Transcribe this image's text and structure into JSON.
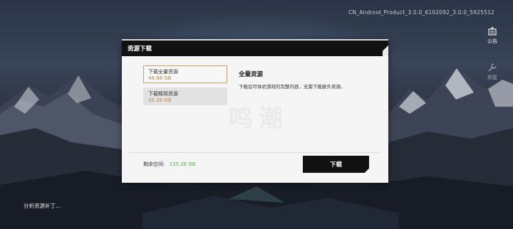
{
  "version": "CN_Android_Product_3.0.0_6102092_3.0.0_5925512",
  "side": {
    "notice_label": "公告",
    "repair_label": "修复"
  },
  "status_text": "分析资源补丁...",
  "dialog": {
    "title": "资源下载",
    "options": [
      {
        "name": "下载全量资源",
        "size": "46.88 GB",
        "selected": true
      },
      {
        "name": "下载精简资源",
        "size": "35.38 GB",
        "selected": false
      }
    ],
    "detail_title": "全量资源",
    "detail_desc": "下载后可体验游戏的完整内容，无需下载额外资源。",
    "space_label": "剩余空间:",
    "space_value": "135.26 GB",
    "download_label": "下载",
    "watermark": "鸣潮"
  },
  "colors": {
    "accent_gold": "#c9a36b",
    "size_text": "#b08a4a",
    "space_green": "#4caf50"
  }
}
